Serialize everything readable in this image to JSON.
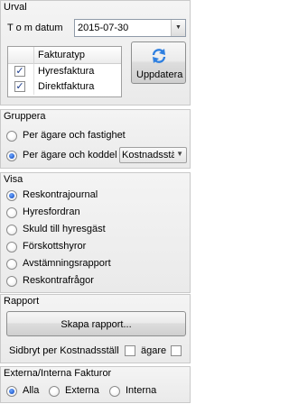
{
  "urval": {
    "title": "Urval",
    "tom_datum_label": "T o m datum",
    "tom_datum_value": "2015-07-30",
    "grid_header": "Fakturatyp",
    "rows": [
      {
        "label": "Hyresfaktura",
        "checked": true
      },
      {
        "label": "Direktfaktura",
        "checked": true
      }
    ],
    "update_button": "Uppdatera"
  },
  "gruppera": {
    "title": "Gruppera",
    "options": [
      {
        "label": "Per ägare och fastighet",
        "checked": false
      },
      {
        "label": "Per ägare och koddel",
        "checked": true
      }
    ],
    "koddel_select": "Kostnadsställe"
  },
  "visa": {
    "title": "Visa",
    "options": [
      {
        "label": "Reskontrajournal",
        "checked": true
      },
      {
        "label": "Hyresfordran",
        "checked": false
      },
      {
        "label": "Skuld till hyresgäst",
        "checked": false
      },
      {
        "label": "Förskottshyror",
        "checked": false
      },
      {
        "label": "Avstämningsrapport",
        "checked": false
      },
      {
        "label": "Reskontrafrågor",
        "checked": false
      }
    ]
  },
  "rapport": {
    "title": "Rapport",
    "create_button": "Skapa rapport...",
    "sidbryt_label": "Sidbryt per Kostnadsställ",
    "agare_label": "ägare"
  },
  "fakturor": {
    "title": "Externa/Interna Fakturor",
    "options": [
      {
        "label": "Alla",
        "checked": true
      },
      {
        "label": "Externa",
        "checked": false
      },
      {
        "label": "Interna",
        "checked": false
      }
    ]
  },
  "colors": {
    "accent": "#1a54c8",
    "panel_border": "#c9c9c9"
  },
  "icons": {
    "update_button_icon": "refresh-arrows-icon"
  }
}
